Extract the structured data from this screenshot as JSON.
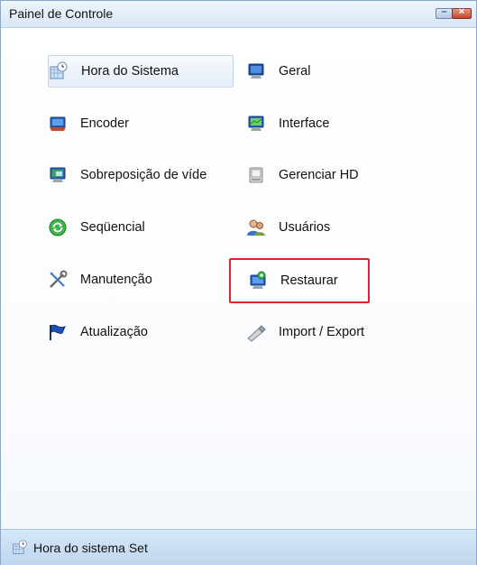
{
  "window": {
    "title": "Painel de Controle",
    "minimize_icon": "minimize-icon",
    "close_icon": "close-icon",
    "minimize_glyph": "–",
    "close_glyph": "×"
  },
  "menu": {
    "items": [
      {
        "label": "Hora do Sistema",
        "icon": "clock-calendar-icon"
      },
      {
        "label": "Geral",
        "icon": "monitor-settings-icon"
      },
      {
        "label": "Encoder",
        "icon": "monitor-encoder-icon"
      },
      {
        "label": "Interface",
        "icon": "monitor-interface-icon"
      },
      {
        "label": "Sobreposição de víde",
        "icon": "video-overlay-icon"
      },
      {
        "label": "Gerenciar HD",
        "icon": "hard-disk-icon"
      },
      {
        "label": "Seqüencial",
        "icon": "sequence-refresh-icon"
      },
      {
        "label": "Usuários",
        "icon": "users-icon"
      },
      {
        "label": "Manutenção",
        "icon": "tools-icon"
      },
      {
        "label": "Restaurar",
        "icon": "restore-icon"
      },
      {
        "label": "Atualização",
        "icon": "update-flag-icon"
      },
      {
        "label": "Import / Export",
        "icon": "usb-drive-icon"
      }
    ],
    "highlight_color": "#e0222a"
  },
  "status": {
    "text": "Hora do sistema Set",
    "icon": "clock-calendar-icon"
  }
}
